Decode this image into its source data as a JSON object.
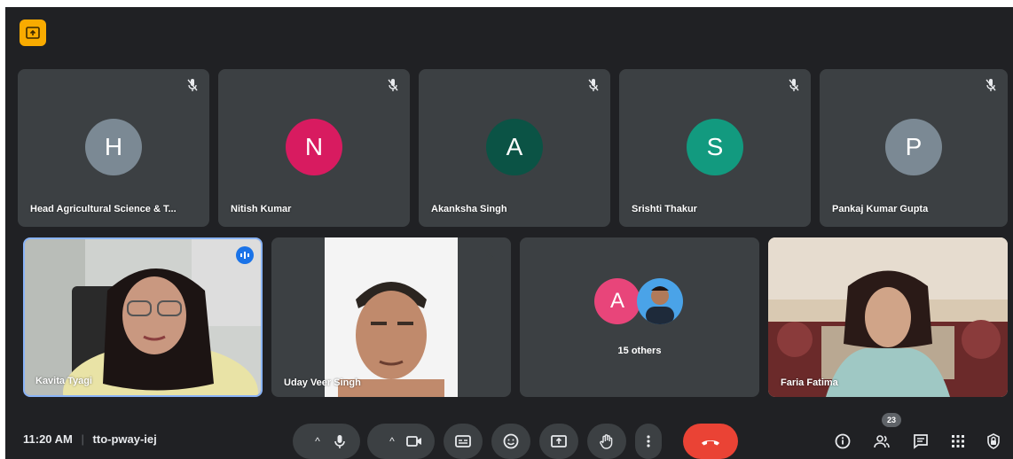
{
  "screen_share_badge": {
    "icon": "present-to-all-icon",
    "color": "#f9ab00"
  },
  "participants_top": [
    {
      "initial": "H",
      "name": "Head Agricultural Science & T...",
      "color": "#7b8994",
      "muted": true
    },
    {
      "initial": "N",
      "name": "Nitish Kumar",
      "color": "#d81b60",
      "muted": true
    },
    {
      "initial": "A",
      "name": "Akanksha Singh",
      "color": "#0b5345",
      "muted": true
    },
    {
      "initial": "S",
      "name": "Srishti Thakur",
      "color": "#129a7f",
      "muted": true
    },
    {
      "initial": "P",
      "name": "Pankaj Kumar Gupta",
      "color": "#7b8994",
      "muted": true
    }
  ],
  "participants_video": [
    {
      "name": "Kavita Tyagi",
      "speaking": true
    },
    {
      "name": "Uday Veer Singh",
      "muted": true
    },
    {
      "name": "Faria Fatima"
    }
  ],
  "others_tile": {
    "initial": "A",
    "avatar_color": "#e8457a",
    "label": "15 others"
  },
  "meeting": {
    "time": "11:20 AM",
    "separator": "|",
    "code": "tto-pway-iej"
  },
  "controls": {
    "mic_options": "^",
    "camera_options": "^",
    "icons": [
      "mic-icon",
      "camera-icon",
      "captions-icon",
      "emoji-icon",
      "present-icon",
      "raise-hand-icon",
      "more-options-icon",
      "end-call-icon"
    ],
    "end_call_color": "#ea4335"
  },
  "right_panel": {
    "participant_count": "23",
    "icons": [
      "info-icon",
      "people-icon",
      "chat-icon",
      "activities-icon",
      "host-controls-icon"
    ]
  }
}
